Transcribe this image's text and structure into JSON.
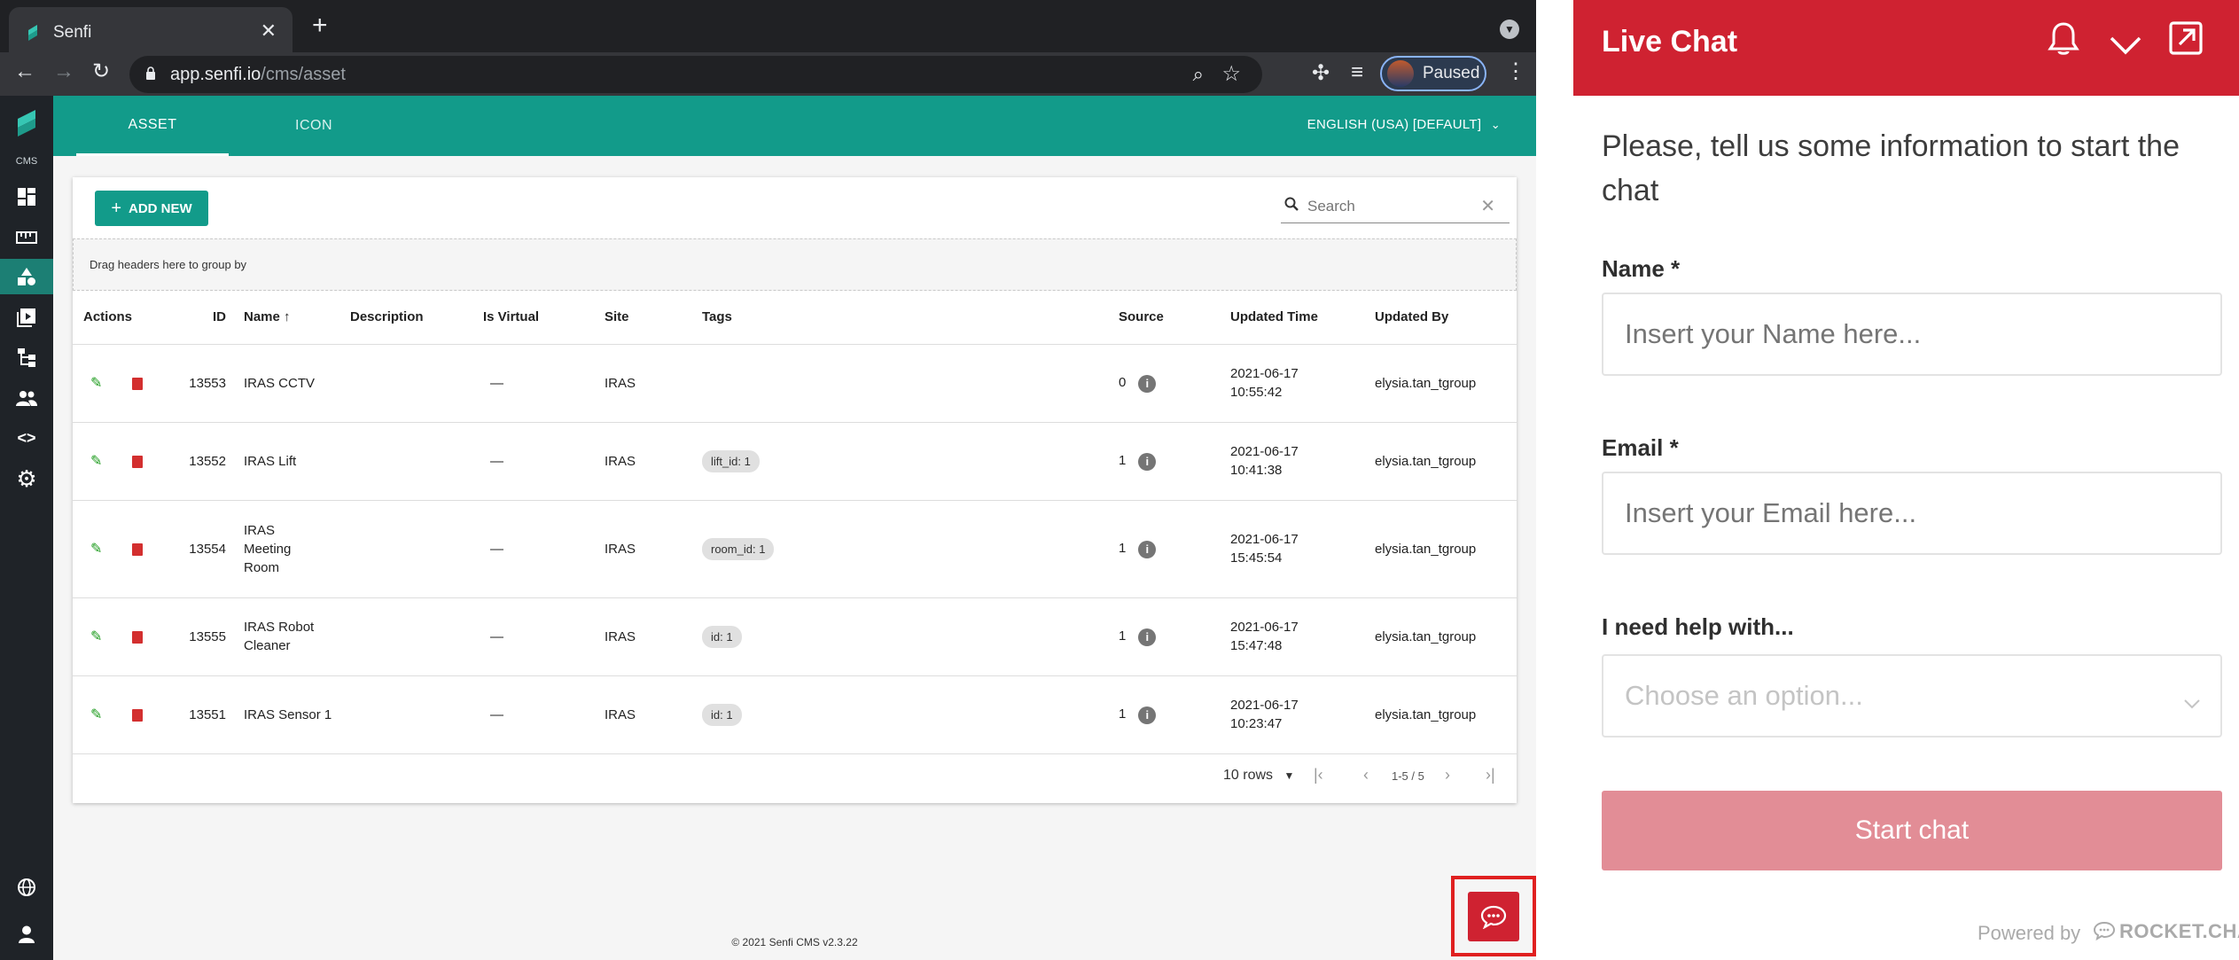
{
  "browser": {
    "tab_title": "Senfi",
    "url_host": "app.senfi.io",
    "url_path": "/cms/asset",
    "profile_status": "Paused"
  },
  "sidebar": {
    "brand_label": "CMS",
    "items": [
      "dashboard-icon",
      "ruler-icon",
      "shapes-icon",
      "media-icon",
      "hierarchy-icon",
      "users-icon",
      "code-icon",
      "gear-icon",
      "globe-icon",
      "account-icon"
    ]
  },
  "topbar": {
    "tabs": [
      {
        "label": "ASSET"
      },
      {
        "label": "ICON"
      }
    ],
    "language": "ENGLISH (USA) [DEFAULT]"
  },
  "toolbar": {
    "add_new_label": "ADD NEW",
    "search_placeholder": "Search",
    "group_hint": "Drag headers here to group by"
  },
  "table": {
    "columns": [
      "Actions",
      "ID",
      "Name",
      "Description",
      "Is Virtual",
      "Site",
      "Tags",
      "Source",
      "Updated Time",
      "Updated By"
    ],
    "rows": [
      {
        "id": "13553",
        "name": "IRAS CCTV",
        "description": "",
        "is_virtual": "—",
        "site": "IRAS",
        "tag": "",
        "source": "0",
        "date": "2021-06-17",
        "time": "10:55:42",
        "updated_by": "elysia.tan_tgroup"
      },
      {
        "id": "13552",
        "name": "IRAS Lift",
        "description": "",
        "is_virtual": "—",
        "site": "IRAS",
        "tag": "lift_id: 1",
        "source": "1",
        "date": "2021-06-17",
        "time": "10:41:38",
        "updated_by": "elysia.tan_tgroup"
      },
      {
        "id": "13554",
        "name": "IRAS Meeting Room",
        "description": "",
        "is_virtual": "—",
        "site": "IRAS",
        "tag": "room_id: 1",
        "source": "1",
        "date": "2021-06-17",
        "time": "15:45:54",
        "updated_by": "elysia.tan_tgroup"
      },
      {
        "id": "13555",
        "name": "IRAS Robot Cleaner",
        "description": "",
        "is_virtual": "—",
        "site": "IRAS",
        "tag": "id: 1",
        "source": "1",
        "date": "2021-06-17",
        "time": "15:47:48",
        "updated_by": "elysia.tan_tgroup"
      },
      {
        "id": "13551",
        "name": "IRAS Sensor 1",
        "description": "",
        "is_virtual": "—",
        "site": "IRAS",
        "tag": "id: 1",
        "source": "1",
        "date": "2021-06-17",
        "time": "10:23:47",
        "updated_by": "elysia.tan_tgroup"
      }
    ]
  },
  "pager": {
    "rows_label": "10 rows",
    "range": "1-5 / 5"
  },
  "footer": "© 2021 Senfi CMS v2.3.22",
  "live_chat": {
    "title": "Live Chat",
    "intro": "Please, tell us some information to start the chat",
    "name_label": "Name *",
    "name_placeholder": "Insert your Name here...",
    "email_label": "Email *",
    "email_placeholder": "Insert your Email here...",
    "help_label": "I need help with...",
    "help_placeholder": "Choose an option...",
    "start_label": "Start chat",
    "powered_by": "Powered by",
    "brand": "ROCKET.CHAT",
    "accent_color": "#cf2231"
  }
}
